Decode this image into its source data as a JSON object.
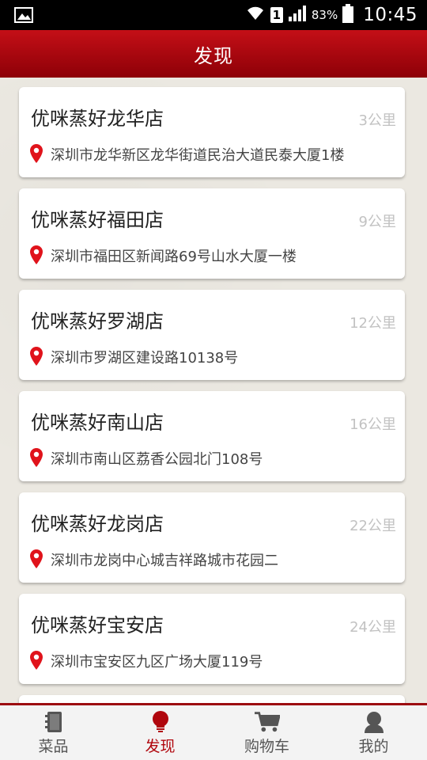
{
  "status_bar": {
    "sim": "1",
    "battery": "83%",
    "time": "10:45"
  },
  "header": {
    "title": "发现"
  },
  "stores": [
    {
      "name": "优咪蒸好龙华店",
      "distance": "3公里",
      "address": "深圳市龙华新区龙华街道民治大道民泰大厦1楼"
    },
    {
      "name": "优咪蒸好福田店",
      "distance": "9公里",
      "address": "深圳市福田区新闻路69号山水大厦一楼"
    },
    {
      "name": "优咪蒸好罗湖店",
      "distance": "12公里",
      "address": "深圳市罗湖区建设路10138号"
    },
    {
      "name": "优咪蒸好南山店",
      "distance": "16公里",
      "address": "深圳市南山区荔香公园北门108号"
    },
    {
      "name": "优咪蒸好龙岗店",
      "distance": "22公里",
      "address": "深圳市龙岗中心城吉祥路城市花园二"
    },
    {
      "name": "优咪蒸好宝安店",
      "distance": "24公里",
      "address": "深圳市宝安区九区广场大厦119号"
    }
  ],
  "bottom_nav": {
    "items": [
      {
        "label": "菜品",
        "icon": "menu-book-icon"
      },
      {
        "label": "发现",
        "icon": "lightbulb-icon",
        "active": true
      },
      {
        "label": "购物车",
        "icon": "cart-icon"
      },
      {
        "label": "我的",
        "icon": "user-icon"
      }
    ]
  },
  "colors": {
    "brand_red": "#b0060d",
    "pin_red": "#e0131b"
  }
}
